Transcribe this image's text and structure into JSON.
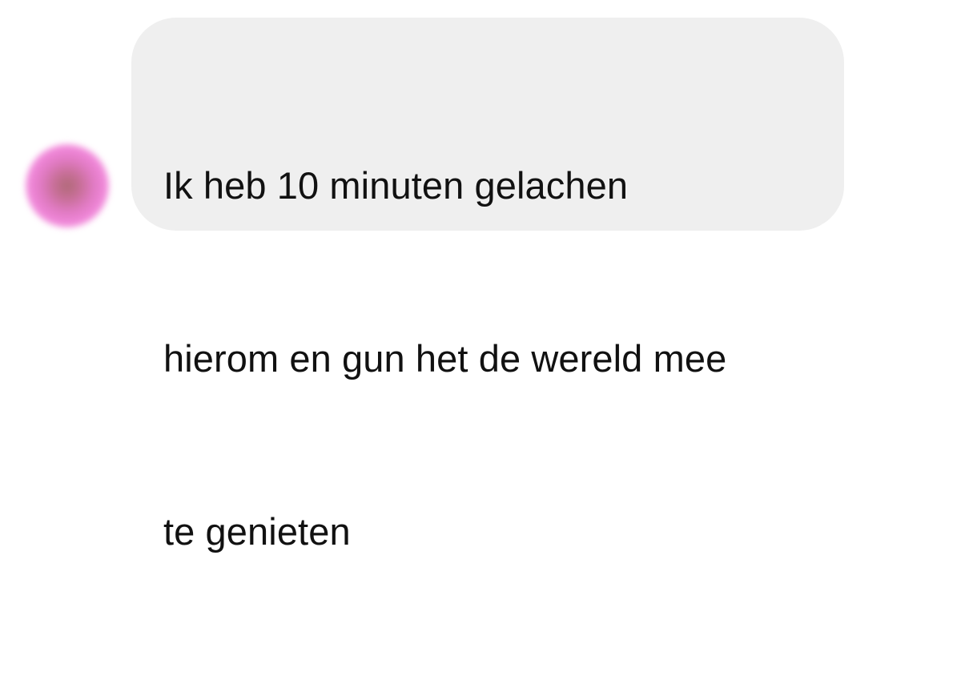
{
  "conversation": {
    "message": {
      "lines": [
        "Ik heb 10 minuten gelachen",
        "hierom en gun het de wereld mee",
        "te genieten"
      ]
    }
  },
  "colors": {
    "bubble_background": "#efefef",
    "text": "#111111",
    "avatar_accent": "#e07ac2"
  }
}
